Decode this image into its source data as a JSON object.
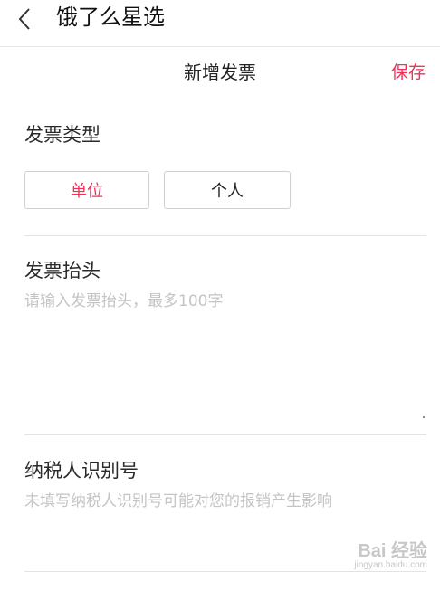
{
  "header": {
    "app_title": "饿了么星选"
  },
  "page": {
    "title": "新增发票",
    "save_label": "保存"
  },
  "invoice_type": {
    "label": "发票类型",
    "options": [
      {
        "label": "单位",
        "selected": true
      },
      {
        "label": "个人",
        "selected": false
      }
    ]
  },
  "invoice_header": {
    "label": "发票抬头",
    "value": "",
    "placeholder": "请输入发票抬头，最多100字"
  },
  "tax_id": {
    "label": "纳税人识别号",
    "value": "",
    "placeholder": "未填写纳税人识别号可能对您的报销产生影响"
  },
  "watermark": {
    "main": "Bai 经验",
    "sub": "jingyan.baidu.com"
  },
  "colors": {
    "accent": "#f0325a",
    "placeholder": "#c4c4c4",
    "divider": "#e3e3e3"
  }
}
